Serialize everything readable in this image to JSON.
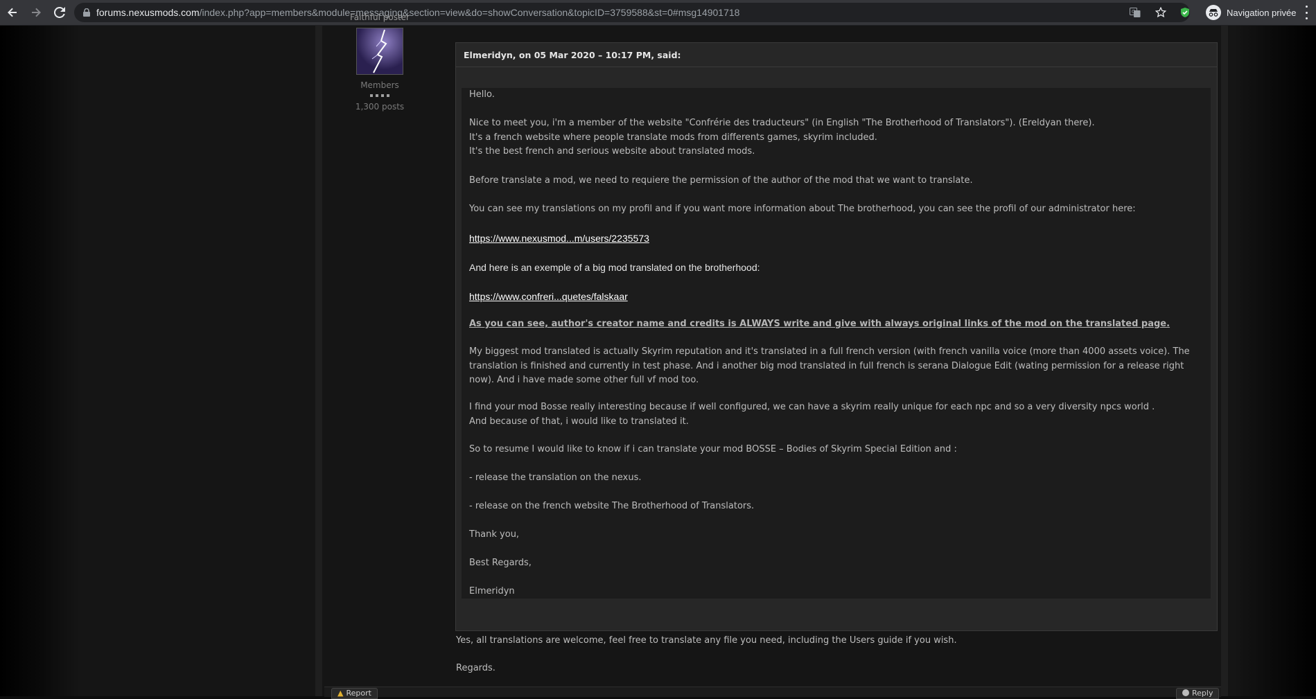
{
  "browser": {
    "url_host": "forums.nexusmods.com",
    "url_path": "/index.php?app=members&module=messaging&section=view&do=showConversation&topicID=3759588&st=0#msg14901718",
    "private_label": "Navigation privée",
    "icons": [
      "back-icon",
      "forward-icon",
      "reload-icon",
      "lock-icon",
      "translate-icon",
      "star-icon",
      "shield-extension-icon",
      "incognito-icon",
      "menu-icon"
    ]
  },
  "author": {
    "title": "Faithful poster",
    "group": "Members",
    "posts": "1,300 posts"
  },
  "quote": {
    "header": "Elmeridyn, on 05 Mar 2020 – 10:17 PM, said:",
    "p1": "Hello.",
    "p2": "Nice to meet you, i'm a member of the website \"Confrérie des traducteurs\" (in English \"The Brotherhood of Translators\"). (Ereldyan there).\nIt's a french website where people translate mods from differents games, skyrim included.\nIt's the best french and serious website about translated mods.",
    "p3": "Before translate a mod, we need to requiere the permission of the author of the mod that we want to translate.",
    "p4": "You can see my translations on my profil and if you want more information about The brotherhood, you can see the profil of our administrator here:",
    "link1": "https://www.nexusmod...m/users/2235573",
    "p5": "And here is an exemple of a big mod translated on the brotherhood:",
    "link2": "https://www.confreri...quetes/falskaar",
    "p6": "As you can see, author's creator name and credits is ALWAYS write and give with always original links of the mod on the translated page.",
    "p7": "My biggest mod translated is actually Skyrim reputation and it's translated in a full french version (with french vanilla voice (more than 4000 assets voice). The translation is finished and currently in test phase. And i another big mod translated in full french is serana Dialogue Edit (wating permission for a release right now).  And i have made some other full vf mod too.",
    "p8": "I find your mod Bosse really interesting because if well configured, we can have a skyrim really unique for each npc and so a very diversity npcs world .\nAnd because of that, i would like to translated it.",
    "p9": "So to resume I would like to know if i can translate your mod BOSSE – Bodies of Skyrim Special Edition and :",
    "p10": "- release the translation on the nexus.",
    "p11": "- release on the french website The Brotherhood of Translators.",
    "p12": "Thank you,",
    "p13": "Best Regards,",
    "p14": "Elmeridyn"
  },
  "reply": {
    "line1": "Yes, all translations are welcome, feel free to translate any file you need, including the Users guide if you wish.",
    "line2": "Regards."
  },
  "buttons": {
    "report": "Report",
    "reply": "Reply"
  }
}
